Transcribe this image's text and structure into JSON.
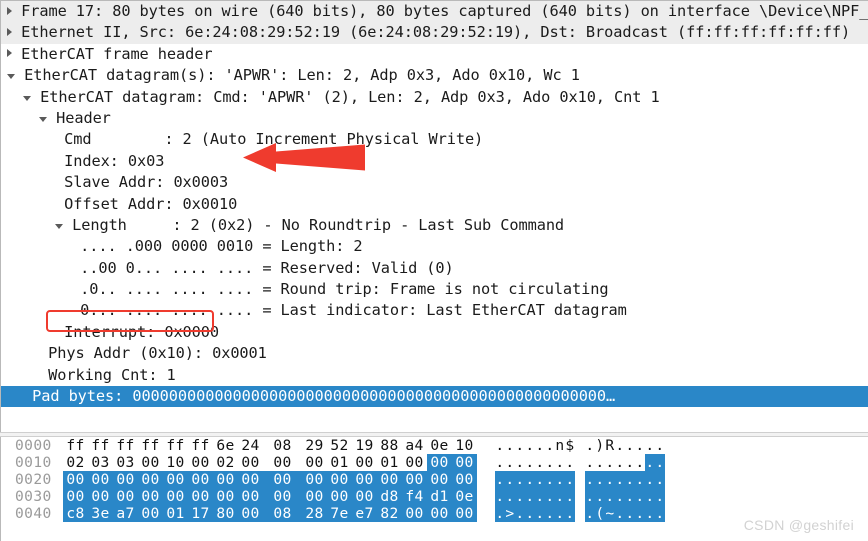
{
  "colors": {
    "selection_blue": "#2a87c8",
    "annotation_red": "#ef3b2e",
    "shade_gray": "#ededed",
    "offset_gray": "#9a9a9a",
    "watermark_gray": "#d2d2d2"
  },
  "detail_tree": {
    "rows": [
      {
        "indent": 0,
        "toggle": "closed",
        "shaded": true,
        "selected": false,
        "text": "Frame 17: 80 bytes on wire (640 bits), 80 bytes captured (640 bits) on interface \\Device\\NPF_"
      },
      {
        "indent": 0,
        "toggle": "closed",
        "shaded": true,
        "selected": false,
        "text": "Ethernet II, Src: 6e:24:08:29:52:19 (6e:24:08:29:52:19), Dst: Broadcast (ff:ff:ff:ff:ff:ff)"
      },
      {
        "indent": 0,
        "toggle": "closed",
        "shaded": false,
        "selected": false,
        "text": "EtherCAT frame header"
      },
      {
        "indent": 0,
        "toggle": "open",
        "shaded": false,
        "selected": false,
        "text": "EtherCAT datagram(s): 'APWR': Len: 2, Adp 0x3, Ado 0x10, Wc 1"
      },
      {
        "indent": 1,
        "toggle": "open",
        "shaded": false,
        "selected": false,
        "text": "EtherCAT datagram: Cmd: 'APWR' (2), Len: 2, Adp 0x3, Ado 0x10, Cnt 1"
      },
      {
        "indent": 2,
        "toggle": "open",
        "shaded": false,
        "selected": false,
        "text": "Header"
      },
      {
        "indent": 3,
        "toggle": "none",
        "shaded": false,
        "selected": false,
        "text": "Cmd        : 2 (Auto Increment Physical Write)"
      },
      {
        "indent": 3,
        "toggle": "none",
        "shaded": false,
        "selected": false,
        "text": "Index: 0x03"
      },
      {
        "indent": 3,
        "toggle": "none",
        "shaded": false,
        "selected": false,
        "text": "Slave Addr: 0x0003"
      },
      {
        "indent": 3,
        "toggle": "none",
        "shaded": false,
        "selected": false,
        "text": "Offset Addr: 0x0010"
      },
      {
        "indent": 3,
        "toggle": "open",
        "shaded": false,
        "selected": false,
        "text": "Length     : 2 (0x2) - No Roundtrip - Last Sub Command"
      },
      {
        "indent": 4,
        "toggle": "none",
        "shaded": false,
        "selected": false,
        "text": ".... .000 0000 0010 = Length: 2"
      },
      {
        "indent": 4,
        "toggle": "none",
        "shaded": false,
        "selected": false,
        "text": "..00 0... .... .... = Reserved: Valid (0)"
      },
      {
        "indent": 4,
        "toggle": "none",
        "shaded": false,
        "selected": false,
        "text": ".0.. .... .... .... = Round trip: Frame is not circulating"
      },
      {
        "indent": 4,
        "toggle": "none",
        "shaded": false,
        "selected": false,
        "text": "0... .... .... .... = Last indicator: Last EtherCAT datagram"
      },
      {
        "indent": 3,
        "toggle": "none",
        "shaded": false,
        "selected": false,
        "text": "Interrupt: 0x0000"
      },
      {
        "indent": 2,
        "toggle": "none",
        "shaded": false,
        "selected": false,
        "text": "Phys Addr (0x10): 0x0001"
      },
      {
        "indent": 2,
        "toggle": "none",
        "shaded": false,
        "selected": false,
        "text": "Working Cnt: 1"
      },
      {
        "indent": 1,
        "toggle": "none",
        "shaded": false,
        "selected": true,
        "text": "Pad bytes: 0000000000000000000000000000000000000000000000000000…"
      }
    ]
  },
  "hex_dump": {
    "rows": [
      {
        "offset": "0000",
        "bytes": [
          "ff",
          "ff",
          "ff",
          "ff",
          "ff",
          "ff",
          "6e",
          "24",
          "08",
          "29",
          "52",
          "19",
          "88",
          "a4",
          "0e",
          "10"
        ],
        "ascii": [
          ".",
          ".",
          ".",
          ".",
          ".",
          ".",
          "n",
          "$",
          ".",
          ")",
          "R",
          ".",
          ".",
          ".",
          ".",
          "."
        ],
        "highlight_from": 16
      },
      {
        "offset": "0010",
        "bytes": [
          "02",
          "03",
          "03",
          "00",
          "10",
          "00",
          "02",
          "00",
          "00",
          "00",
          "01",
          "00",
          "01",
          "00",
          "00",
          "00"
        ],
        "ascii": [
          ".",
          ".",
          ".",
          ".",
          ".",
          ".",
          ".",
          ".",
          ".",
          ".",
          ".",
          ".",
          ".",
          ".",
          ".",
          "."
        ],
        "highlight_from": 14
      },
      {
        "offset": "0020",
        "bytes": [
          "00",
          "00",
          "00",
          "00",
          "00",
          "00",
          "00",
          "00",
          "00",
          "00",
          "00",
          "00",
          "00",
          "00",
          "00",
          "00"
        ],
        "ascii": [
          ".",
          ".",
          ".",
          ".",
          ".",
          ".",
          ".",
          ".",
          ".",
          ".",
          ".",
          ".",
          ".",
          ".",
          ".",
          "."
        ],
        "highlight_from": 0
      },
      {
        "offset": "0030",
        "bytes": [
          "00",
          "00",
          "00",
          "00",
          "00",
          "00",
          "00",
          "00",
          "00",
          "00",
          "00",
          "00",
          "d8",
          "f4",
          "d1",
          "0e"
        ],
        "ascii": [
          ".",
          ".",
          ".",
          ".",
          ".",
          ".",
          ".",
          ".",
          ".",
          ".",
          ".",
          ".",
          ".",
          ".",
          ".",
          "."
        ],
        "highlight_from": 0
      },
      {
        "offset": "0040",
        "bytes": [
          "c8",
          "3e",
          "a7",
          "00",
          "01",
          "17",
          "80",
          "00",
          "08",
          "28",
          "7e",
          "e7",
          "82",
          "00",
          "00",
          "00"
        ],
        "ascii": [
          ".",
          ">",
          ".",
          ".",
          ".",
          ".",
          ".",
          ".",
          ".",
          "(",
          "~",
          ".",
          ".",
          ".",
          ".",
          "."
        ],
        "highlight_from": 0
      }
    ]
  },
  "annotations": {
    "arrow_target": "Slave Addr: 0x0003",
    "box_target": "Working Cnt: 1"
  },
  "watermark": {
    "text": "CSDN @geshifei"
  }
}
